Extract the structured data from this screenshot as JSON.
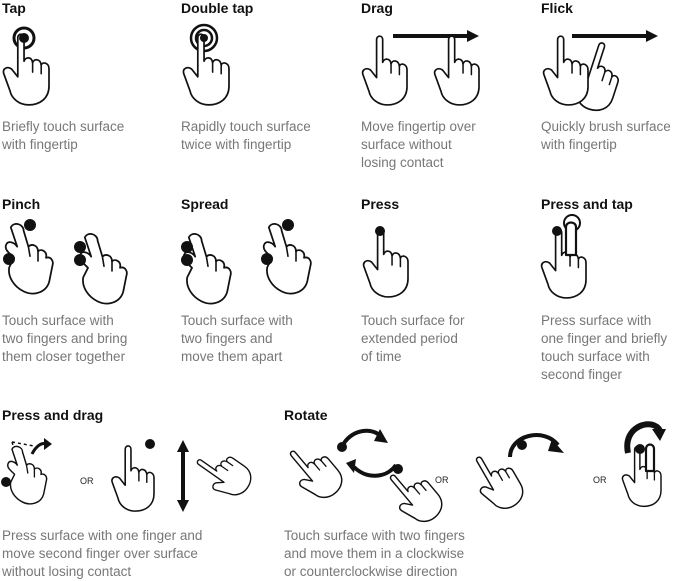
{
  "gestures": [
    {
      "title": "Tap",
      "desc": [
        "Briefly touch surface",
        "with fingertip"
      ]
    },
    {
      "title": "Double tap",
      "desc": [
        "Rapidly touch surface",
        "twice with fingertip"
      ]
    },
    {
      "title": "Drag",
      "desc": [
        "Move fingertip over",
        "surface without",
        "losing contact"
      ]
    },
    {
      "title": "Flick",
      "desc": [
        "Quickly brush surface",
        "with fingertip"
      ]
    },
    {
      "title": "Pinch",
      "desc": [
        "Touch surface with",
        "two fingers and bring",
        "them closer together"
      ]
    },
    {
      "title": "Spread",
      "desc": [
        "Touch surface with",
        "two fingers and",
        "move them apart"
      ]
    },
    {
      "title": "Press",
      "desc": [
        "Touch surface for",
        "extended period",
        "of time"
      ]
    },
    {
      "title": "Press and tap",
      "desc": [
        "Press surface with",
        "one finger and briefly",
        "touch surface with",
        "second finger"
      ]
    },
    {
      "title": "Press and drag",
      "desc": [
        "Press surface with one finger and",
        "move second finger over surface",
        "without losing contact"
      ]
    },
    {
      "title": "Rotate",
      "desc": [
        "Touch surface with two fingers",
        "and move them in a clockwise",
        "or counterclockwise direction"
      ]
    }
  ],
  "or_label": "OR"
}
